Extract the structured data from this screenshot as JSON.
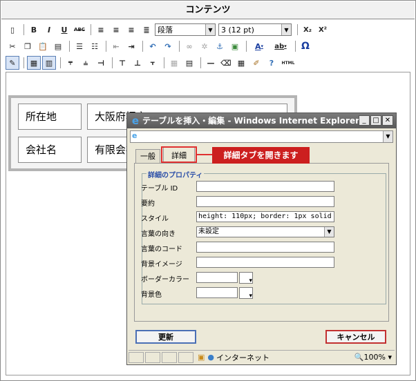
{
  "window": {
    "title": "コンテンツ"
  },
  "toolbar1": {
    "bold": "B",
    "italic": "I",
    "underline": "U",
    "strike": "ABC",
    "format_select": "段落",
    "size_select": "3 (12 pt)",
    "subscript": "X₂",
    "superscript": "X²"
  },
  "toolbar2": {
    "font_color": "A",
    "highlight": "ab",
    "omega": "Ω"
  },
  "toolbar3": {
    "html": "HTML"
  },
  "table": {
    "cells": [
      "所在地",
      "大阪府堺市",
      "会社名",
      "有限会社"
    ]
  },
  "dialog": {
    "title": "テーブルを挿入・編集 - Windows Internet Explorer",
    "tabs": [
      "一般",
      "詳細"
    ],
    "group_title": "詳細のプロパティ",
    "fields": [
      {
        "label": "テーブル ID",
        "value": ""
      },
      {
        "label": "要約",
        "value": ""
      },
      {
        "label": "スタイル",
        "value": "height: 110px; border: 1px solid"
      },
      {
        "label": "言葉の向き",
        "value": "未設定"
      },
      {
        "label": "言葉のコード",
        "value": ""
      },
      {
        "label": "背景イメージ",
        "value": ""
      },
      {
        "label": "ボーダーカラー",
        "value": ""
      },
      {
        "label": "背景色",
        "value": ""
      }
    ],
    "update_button": "更新",
    "cancel_button": "キャンセル",
    "status_zone": "インターネット",
    "zoom": "100%"
  },
  "annotation": {
    "callout": "詳細タブを開きます"
  },
  "colors": {
    "callout_bg": "#cc1f1f",
    "highlight_border": "#e03030",
    "dialog_bg": "#ece9d8"
  }
}
